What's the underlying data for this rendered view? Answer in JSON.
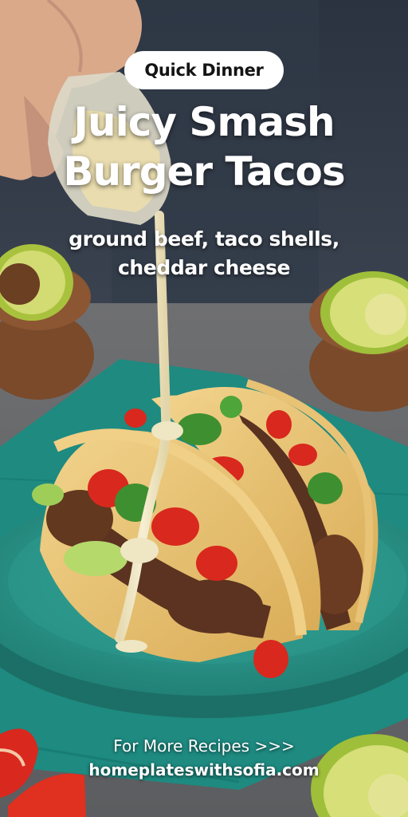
{
  "badge": {
    "label": "Quick Dinner"
  },
  "title": {
    "line1": "Juicy Smash",
    "line2": "Burger Tacos"
  },
  "subtitle": {
    "line1": "ground beef, taco shells,",
    "line2": "cheddar cheese"
  },
  "footer": {
    "cta": "For More Recipes >>>",
    "website": "homeplateswithsofia.com"
  },
  "colors": {
    "plate": "#2f9c90",
    "napkin": "#1e8a80",
    "taco_shell": "#e9c77a",
    "sauce": "#efe6c4",
    "tomato": "#d9281e",
    "avocado": "#b7cc4a"
  }
}
